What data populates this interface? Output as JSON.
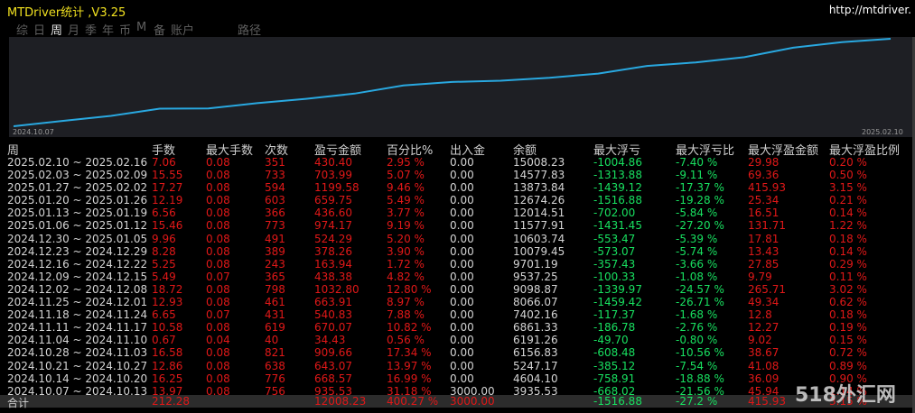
{
  "app": {
    "title": "MTDriver统计 ,V3.25",
    "url": "http://mtdriver."
  },
  "tabs": [
    {
      "label": "综"
    },
    {
      "label": "日"
    },
    {
      "label": "周",
      "active": true
    },
    {
      "label": "月"
    },
    {
      "label": "季"
    },
    {
      "label": "年"
    },
    {
      "label": "币"
    },
    {
      "label": "M"
    },
    {
      "label": "备"
    },
    {
      "label": "账户"
    },
    {
      "label": "路径"
    }
  ],
  "chart": {
    "x_start": "2024.10.07",
    "x_end": "2025.02.10",
    "line_color": "#29a8e0"
  },
  "chart_data": {
    "type": "line",
    "x": [
      "2024.10.07",
      "2024.10.14",
      "2024.10.21",
      "2024.10.28",
      "2024.11.04",
      "2024.11.11",
      "2024.11.18",
      "2024.11.25",
      "2024.12.02",
      "2024.12.09",
      "2024.12.16",
      "2024.12.23",
      "2024.12.30",
      "2025.01.06",
      "2025.01.13",
      "2025.01.20",
      "2025.01.27",
      "2025.02.03",
      "2025.02.10"
    ],
    "series": [
      {
        "values": [
          3935.53,
          4604.1,
          5247.17,
          6156.83,
          6191.26,
          6861.33,
          7402.16,
          8066.07,
          9098.87,
          9537.25,
          9701.19,
          10079.45,
          10603.74,
          11577.91,
          12014.51,
          12674.26,
          13873.84,
          14577.83,
          15008.23
        ]
      }
    ]
  },
  "columns": {
    "period": "周",
    "lots": "手数",
    "max_lots": "最大手数",
    "count": "次数",
    "pnl": "盈亏金额",
    "pct": "百分比%",
    "deposit": "出入金",
    "balance": "余额",
    "max_float_loss": "最大浮亏",
    "max_float_loss_pct": "最大浮亏比",
    "max_float_profit": "最大浮盈金额",
    "max_float_profit_pct": "最大浮盈比例"
  },
  "rows": [
    [
      "2025.02.10 ~ 2025.02.16",
      "7.06",
      "0.08",
      "351",
      "430.40",
      "2.95 %",
      "0.00",
      "15008.23",
      "-1004.86",
      "-7.40 %",
      "29.98",
      "0.20 %"
    ],
    [
      "2025.02.03 ~ 2025.02.09",
      "15.55",
      "0.08",
      "733",
      "703.99",
      "5.07 %",
      "0.00",
      "14577.83",
      "-1313.88",
      "-9.11 %",
      "69.36",
      "0.50 %"
    ],
    [
      "2025.01.27 ~ 2025.02.02",
      "17.27",
      "0.08",
      "594",
      "1199.58",
      "9.46 %",
      "0.00",
      "13873.84",
      "-1439.12",
      "-17.37 %",
      "415.93",
      "3.15 %"
    ],
    [
      "2025.01.20 ~ 2025.01.26",
      "12.19",
      "0.08",
      "603",
      "659.75",
      "5.49 %",
      "0.00",
      "12674.26",
      "-1516.88",
      "-19.28 %",
      "25.34",
      "0.21 %"
    ],
    [
      "2025.01.13 ~ 2025.01.19",
      "6.56",
      "0.08",
      "366",
      "436.60",
      "3.77 %",
      "0.00",
      "12014.51",
      "-702.00",
      "-5.84 %",
      "16.51",
      "0.14 %"
    ],
    [
      "2025.01.06 ~ 2025.01.12",
      "15.46",
      "0.08",
      "773",
      "974.17",
      "9.19 %",
      "0.00",
      "11577.91",
      "-1431.45",
      "-27.20 %",
      "131.71",
      "1.22 %"
    ],
    [
      "2024.12.30 ~ 2025.01.05",
      "9.96",
      "0.08",
      "491",
      "524.29",
      "5.20 %",
      "0.00",
      "10603.74",
      "-553.47",
      "-5.39 %",
      "17.81",
      "0.18 %"
    ],
    [
      "2024.12.23 ~ 2024.12.29",
      "8.28",
      "0.08",
      "389",
      "378.26",
      "3.90 %",
      "0.00",
      "10079.45",
      "-573.07",
      "-5.74 %",
      "13.43",
      "0.14 %"
    ],
    [
      "2024.12.16 ~ 2024.12.22",
      "5.25",
      "0.08",
      "243",
      "163.94",
      "1.72 %",
      "0.00",
      "9701.19",
      "-357.43",
      "-3.66 %",
      "27.85",
      "0.29 %"
    ],
    [
      "2024.12.09 ~ 2024.12.15",
      "5.49",
      "0.07",
      "365",
      "438.38",
      "4.82 %",
      "0.00",
      "9537.25",
      "-100.33",
      "-1.08 %",
      "9.79",
      "0.11 %"
    ],
    [
      "2024.12.02 ~ 2024.12.08",
      "18.72",
      "0.08",
      "798",
      "1032.80",
      "12.80 %",
      "0.00",
      "9098.87",
      "-1339.97",
      "-24.57 %",
      "265.71",
      "3.02 %"
    ],
    [
      "2024.11.25 ~ 2024.12.01",
      "12.93",
      "0.08",
      "461",
      "663.91",
      "8.97 %",
      "0.00",
      "8066.07",
      "-1459.42",
      "-26.71 %",
      "49.34",
      "0.62 %"
    ],
    [
      "2024.11.18 ~ 2024.11.24",
      "6.65",
      "0.07",
      "431",
      "540.83",
      "7.88 %",
      "0.00",
      "7402.16",
      "-117.37",
      "-1.68 %",
      "12.8",
      "0.18 %"
    ],
    [
      "2024.11.11 ~ 2024.11.17",
      "10.58",
      "0.08",
      "619",
      "670.07",
      "10.82 %",
      "0.00",
      "6861.33",
      "-186.78",
      "-2.76 %",
      "12.27",
      "0.19 %"
    ],
    [
      "2024.11.04 ~ 2024.11.10",
      "0.67",
      "0.04",
      "40",
      "34.43",
      "0.56 %",
      "0.00",
      "6191.26",
      "-49.70",
      "-0.80 %",
      "9.02",
      "0.15 %"
    ],
    [
      "2024.10.28 ~ 2024.11.03",
      "16.58",
      "0.08",
      "821",
      "909.66",
      "17.34 %",
      "0.00",
      "6156.83",
      "-608.48",
      "-10.56 %",
      "38.67",
      "0.72 %"
    ],
    [
      "2024.10.21 ~ 2024.10.27",
      "12.86",
      "0.08",
      "638",
      "643.07",
      "13.97 %",
      "0.00",
      "5247.17",
      "-385.12",
      "-7.54 %",
      "41.08",
      "0.89 %"
    ],
    [
      "2024.10.14 ~ 2024.10.20",
      "16.25",
      "0.08",
      "776",
      "668.57",
      "16.99 %",
      "0.00",
      "4604.10",
      "-758.91",
      "-18.88 %",
      "36.09",
      "0.90 %"
    ],
    [
      "2024.10.07 ~ 2024.10.13",
      "13.97",
      "0.08",
      "756",
      "935.53",
      "31.18 %",
      "3000.00",
      "3935.53",
      "-668.02",
      "-21.56 %",
      "45.94",
      "1.14 %"
    ]
  ],
  "total": [
    "合计",
    "212.28",
    "",
    "",
    "12008.23",
    "400.27 %",
    "3000.00",
    "",
    "-1516.88",
    "-27.2 %",
    "415.93",
    "3.15 %"
  ],
  "watermark": "518外汇网",
  "colors": {
    "title": "#f0e020",
    "positive": "#e01818",
    "negative": "#18e060",
    "neutral": "#d4d4d4"
  }
}
